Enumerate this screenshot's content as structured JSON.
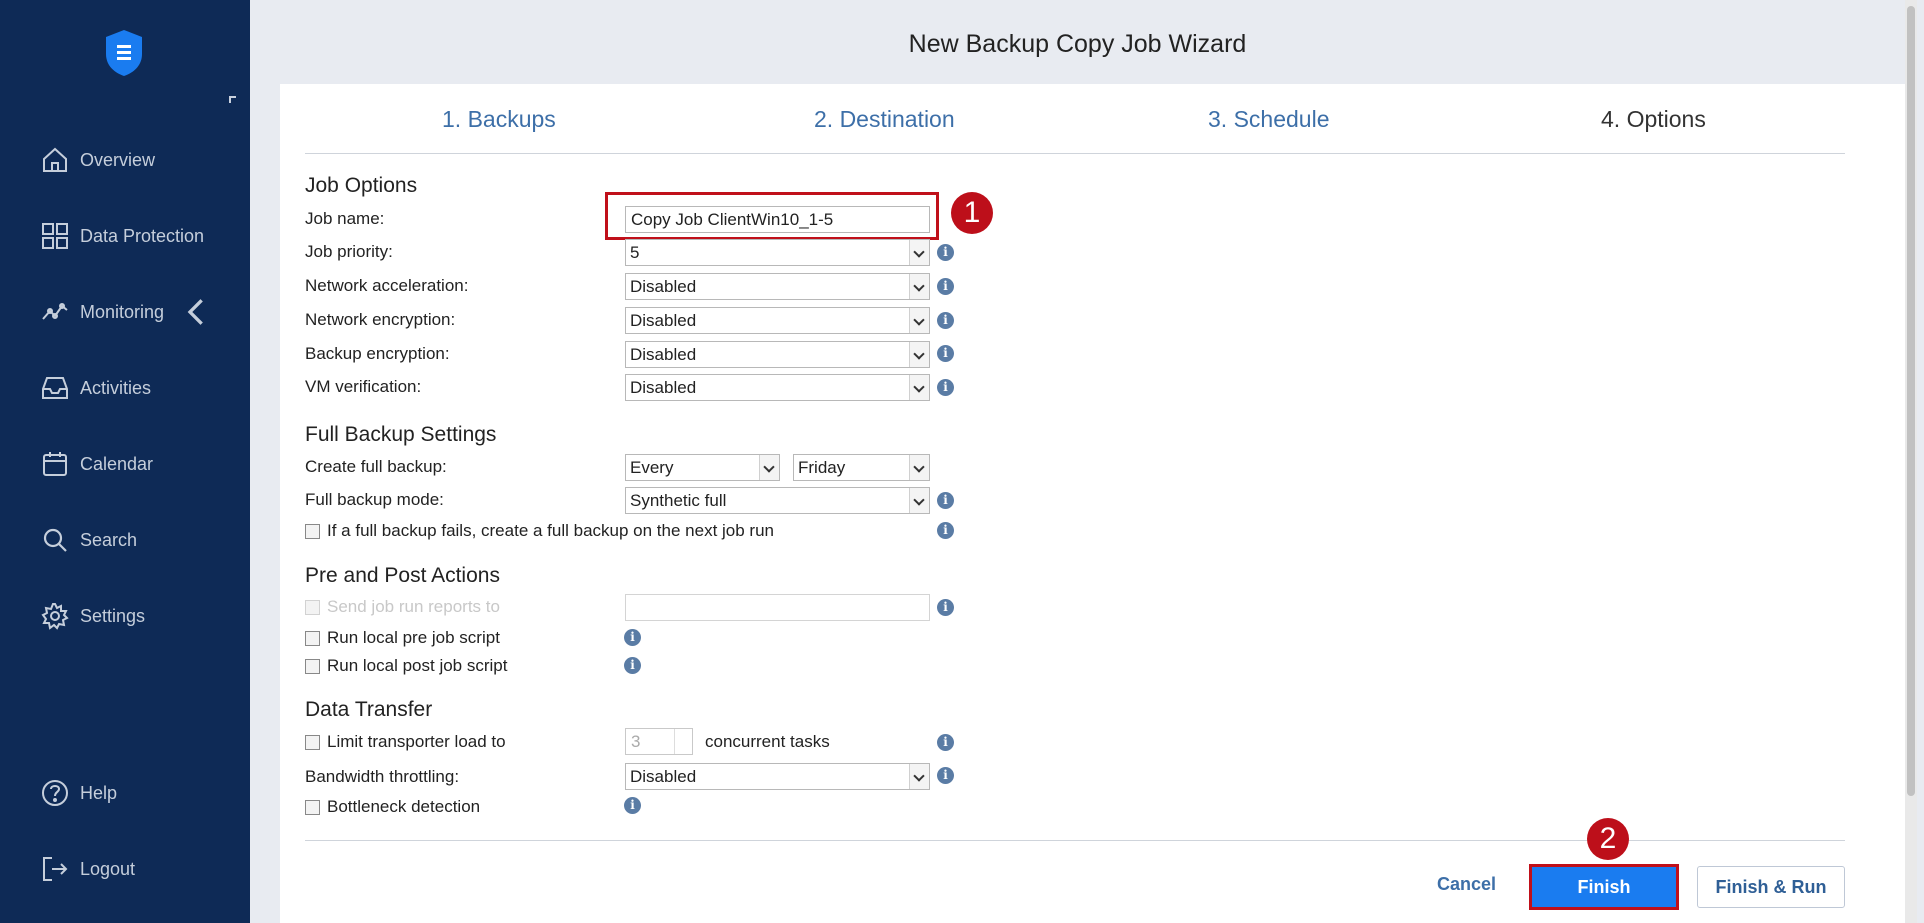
{
  "sidebar": {
    "items": [
      {
        "label": "Overview",
        "icon": "home-icon"
      },
      {
        "label": "Data Protection",
        "icon": "grid-icon"
      },
      {
        "label": "Monitoring",
        "icon": "chart-line-icon"
      },
      {
        "label": "Activities",
        "icon": "inbox-icon"
      },
      {
        "label": "Calendar",
        "icon": "calendar-icon"
      },
      {
        "label": "Search",
        "icon": "search-icon"
      },
      {
        "label": "Settings",
        "icon": "gear-icon"
      },
      {
        "label": "Help",
        "icon": "help-icon"
      },
      {
        "label": "Logout",
        "icon": "logout-icon"
      }
    ]
  },
  "wizard": {
    "title": "New Backup Copy Job Wizard",
    "steps": [
      "1. Backups",
      "2. Destination",
      "3. Schedule",
      "4. Options"
    ],
    "active_step": "4. Options"
  },
  "job_options": {
    "title": "Job Options",
    "job_name_label": "Job name:",
    "job_name_value": "Copy Job ClientWin10_1-5",
    "job_priority_label": "Job priority:",
    "job_priority_value": "5",
    "network_acceleration_label": "Network acceleration:",
    "network_acceleration_value": "Disabled",
    "network_encryption_label": "Network encryption:",
    "network_encryption_value": "Disabled",
    "backup_encryption_label": "Backup encryption:",
    "backup_encryption_value": "Disabled",
    "vm_verification_label": "VM verification:",
    "vm_verification_value": "Disabled"
  },
  "full_backup": {
    "title": "Full Backup Settings",
    "create_label": "Create full backup:",
    "create_frequency": "Every",
    "create_day": "Friday",
    "mode_label": "Full backup mode:",
    "mode_value": "Synthetic full",
    "fail_checkbox_label": "If a full backup fails, create a full backup on the next job run"
  },
  "pre_post": {
    "title": "Pre and Post Actions",
    "send_reports_label": "Send job run reports to",
    "pre_script_label": "Run local pre job script",
    "post_script_label": "Run local post job script"
  },
  "data_transfer": {
    "title": "Data Transfer",
    "limit_label": "Limit transporter load to",
    "limit_value": "3",
    "limit_suffix": "concurrent tasks",
    "bandwidth_label": "Bandwidth throttling:",
    "bandwidth_value": "Disabled",
    "bottleneck_label": "Bottleneck detection"
  },
  "annotations": {
    "badge1": "1",
    "badge2": "2"
  },
  "footer": {
    "cancel": "Cancel",
    "finish": "Finish",
    "finish_run": "Finish & Run"
  },
  "colors": {
    "sidebar_bg": "#0e2a56",
    "accent": "#1a7cf0",
    "highlight": "#c0101a",
    "link": "#3d6fa8"
  }
}
